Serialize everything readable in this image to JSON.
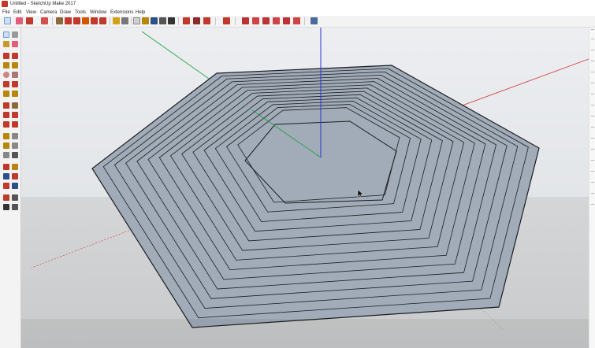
{
  "window": {
    "title": "Untitled - SketchUp Make 2017"
  },
  "menu": [
    "File",
    "Edit",
    "View",
    "Camera",
    "Draw",
    "Tools",
    "Window",
    "Extensions",
    "Help"
  ],
  "colors": {
    "x_axis": "#d32f2f",
    "y_axis": "#1e9e3a",
    "z_axis": "#2a33d6",
    "face": "#a1acb8",
    "sky": "#e9ebee",
    "ground": "#cfd1d3",
    "edge": "#1a1d22"
  },
  "toolbar_icons": [
    "select-icon",
    "eraser-icon",
    "pencil-icon",
    "arc-icon",
    "push-pull-icon",
    "move-icon",
    "rotate-icon",
    "scale-icon",
    "offset-icon",
    "orbit-icon",
    "pan-icon",
    "zoom-icon",
    "zoom-extents-icon",
    "warehouse-icon",
    "extension-icon",
    "ruby-icon",
    "views-icon",
    "iso-icon",
    "top-icon",
    "front-icon",
    "right-icon",
    "back-icon",
    "left-icon",
    "styles-icon"
  ],
  "sidebar_icons": [
    "select-icon",
    "component-icon",
    "paint-icon",
    "eraser-icon",
    "line-icon",
    "freehand-icon",
    "rectangle-icon",
    "rotated-rectangle-icon",
    "circle-icon",
    "polygon-icon",
    "arc-icon",
    "pie-icon",
    "three-point-arc-icon",
    "two-point-arc-icon",
    "move-icon",
    "push-pull-icon",
    "rotate-icon",
    "follow-me-icon",
    "scale-icon",
    "offset-icon",
    "tape-measure-icon",
    "text-icon",
    "protractor-icon",
    "axes-icon",
    "dimension-icon",
    "3d-text-icon",
    "orbit-icon",
    "pan-icon",
    "zoom-icon",
    "zoom-window-icon",
    "zoom-extents-icon",
    "previous-view-icon",
    "position-camera-icon",
    "look-around-icon",
    "walk-icon",
    "section-plane-icon"
  ]
}
